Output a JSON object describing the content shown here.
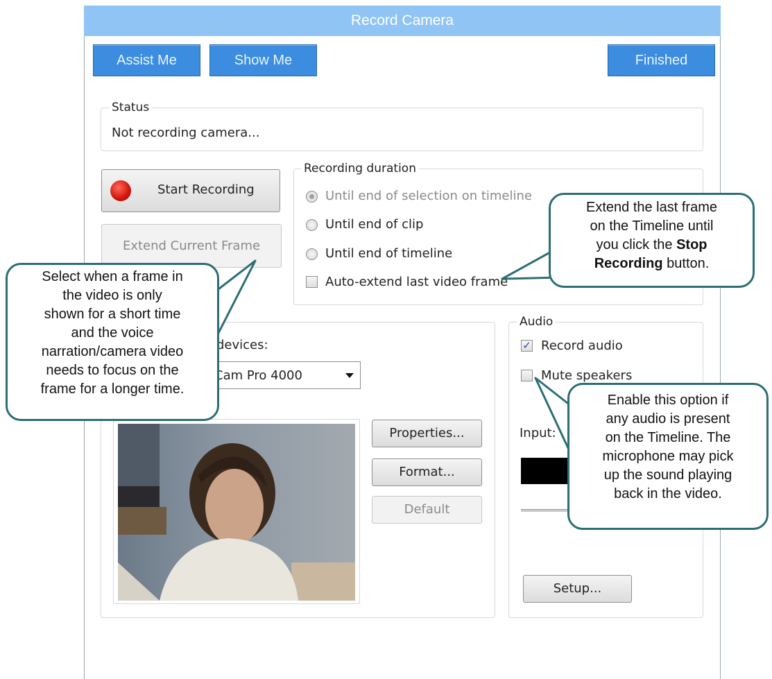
{
  "window": {
    "title": "Record Camera"
  },
  "toolbar": {
    "assist_label": "Assist Me",
    "show_label": "Show Me",
    "finished_label": "Finished"
  },
  "status": {
    "group_label": "Status",
    "text": "Not recording camera..."
  },
  "recording": {
    "start_label": "Start Recording",
    "extend_label": "Extend Current Frame"
  },
  "duration": {
    "group_label": "Recording duration",
    "options": [
      {
        "label": "Until end of selection on timeline",
        "selected": true,
        "enabled": false
      },
      {
        "label": "Until end of clip",
        "selected": false,
        "enabled": true
      },
      {
        "label": "Until end of timeline",
        "selected": false,
        "enabled": true
      }
    ],
    "auto_extend_label": "Auto-extend last video frame",
    "auto_extend_checked": false
  },
  "video": {
    "devices_label": "devices:",
    "device_value": "Cam Pro 4000",
    "properties_label": "Properties...",
    "format_label": "Format...",
    "default_label": "Default"
  },
  "audio": {
    "group_label": "Audio",
    "record_audio_label": "Record audio",
    "record_audio_checked": true,
    "mute_label": "Mute speakers",
    "mute_checked": false,
    "input_label": "Input:",
    "setup_label": "Setup..."
  },
  "callouts": {
    "extend_frame": {
      "line1": "Select when a frame in",
      "line2": "the video is only",
      "line3": "shown for a short time",
      "line4": "and the voice",
      "line5": "narration/camera video",
      "line6": "needs to focus on the",
      "line7": "frame for a longer time."
    },
    "auto_extend": {
      "line1": "Extend the last frame",
      "line2": "on the Timeline until",
      "line3a": "you click the ",
      "line3b": "Stop",
      "line4a": "Recording",
      "line4b": " button."
    },
    "mute": {
      "line1": "Enable this option if",
      "line2": "any audio is present",
      "line3": "on the Timeline. The",
      "line4": "microphone may pick",
      "line5": "up the sound playing",
      "line6": "back in the video."
    }
  },
  "colors": {
    "title_bar": "#8fc4f5",
    "blue_button": "#3c8de0",
    "callout_border": "#2c6e72"
  }
}
